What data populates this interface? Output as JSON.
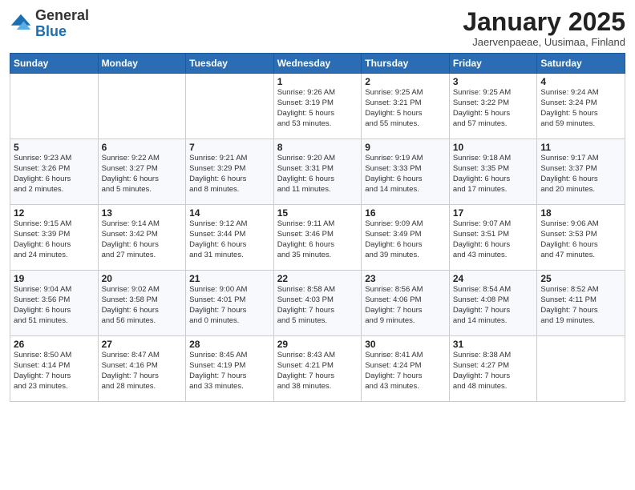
{
  "header": {
    "logo_general": "General",
    "logo_blue": "Blue",
    "month_title": "January 2025",
    "subtitle": "Jaervenpaeae, Uusimaa, Finland"
  },
  "weekdays": [
    "Sunday",
    "Monday",
    "Tuesday",
    "Wednesday",
    "Thursday",
    "Friday",
    "Saturday"
  ],
  "weeks": [
    [
      {
        "day": "",
        "info": ""
      },
      {
        "day": "",
        "info": ""
      },
      {
        "day": "",
        "info": ""
      },
      {
        "day": "1",
        "info": "Sunrise: 9:26 AM\nSunset: 3:19 PM\nDaylight: 5 hours\nand 53 minutes."
      },
      {
        "day": "2",
        "info": "Sunrise: 9:25 AM\nSunset: 3:21 PM\nDaylight: 5 hours\nand 55 minutes."
      },
      {
        "day": "3",
        "info": "Sunrise: 9:25 AM\nSunset: 3:22 PM\nDaylight: 5 hours\nand 57 minutes."
      },
      {
        "day": "4",
        "info": "Sunrise: 9:24 AM\nSunset: 3:24 PM\nDaylight: 5 hours\nand 59 minutes."
      }
    ],
    [
      {
        "day": "5",
        "info": "Sunrise: 9:23 AM\nSunset: 3:26 PM\nDaylight: 6 hours\nand 2 minutes."
      },
      {
        "day": "6",
        "info": "Sunrise: 9:22 AM\nSunset: 3:27 PM\nDaylight: 6 hours\nand 5 minutes."
      },
      {
        "day": "7",
        "info": "Sunrise: 9:21 AM\nSunset: 3:29 PM\nDaylight: 6 hours\nand 8 minutes."
      },
      {
        "day": "8",
        "info": "Sunrise: 9:20 AM\nSunset: 3:31 PM\nDaylight: 6 hours\nand 11 minutes."
      },
      {
        "day": "9",
        "info": "Sunrise: 9:19 AM\nSunset: 3:33 PM\nDaylight: 6 hours\nand 14 minutes."
      },
      {
        "day": "10",
        "info": "Sunrise: 9:18 AM\nSunset: 3:35 PM\nDaylight: 6 hours\nand 17 minutes."
      },
      {
        "day": "11",
        "info": "Sunrise: 9:17 AM\nSunset: 3:37 PM\nDaylight: 6 hours\nand 20 minutes."
      }
    ],
    [
      {
        "day": "12",
        "info": "Sunrise: 9:15 AM\nSunset: 3:39 PM\nDaylight: 6 hours\nand 24 minutes."
      },
      {
        "day": "13",
        "info": "Sunrise: 9:14 AM\nSunset: 3:42 PM\nDaylight: 6 hours\nand 27 minutes."
      },
      {
        "day": "14",
        "info": "Sunrise: 9:12 AM\nSunset: 3:44 PM\nDaylight: 6 hours\nand 31 minutes."
      },
      {
        "day": "15",
        "info": "Sunrise: 9:11 AM\nSunset: 3:46 PM\nDaylight: 6 hours\nand 35 minutes."
      },
      {
        "day": "16",
        "info": "Sunrise: 9:09 AM\nSunset: 3:49 PM\nDaylight: 6 hours\nand 39 minutes."
      },
      {
        "day": "17",
        "info": "Sunrise: 9:07 AM\nSunset: 3:51 PM\nDaylight: 6 hours\nand 43 minutes."
      },
      {
        "day": "18",
        "info": "Sunrise: 9:06 AM\nSunset: 3:53 PM\nDaylight: 6 hours\nand 47 minutes."
      }
    ],
    [
      {
        "day": "19",
        "info": "Sunrise: 9:04 AM\nSunset: 3:56 PM\nDaylight: 6 hours\nand 51 minutes."
      },
      {
        "day": "20",
        "info": "Sunrise: 9:02 AM\nSunset: 3:58 PM\nDaylight: 6 hours\nand 56 minutes."
      },
      {
        "day": "21",
        "info": "Sunrise: 9:00 AM\nSunset: 4:01 PM\nDaylight: 7 hours\nand 0 minutes."
      },
      {
        "day": "22",
        "info": "Sunrise: 8:58 AM\nSunset: 4:03 PM\nDaylight: 7 hours\nand 5 minutes."
      },
      {
        "day": "23",
        "info": "Sunrise: 8:56 AM\nSunset: 4:06 PM\nDaylight: 7 hours\nand 9 minutes."
      },
      {
        "day": "24",
        "info": "Sunrise: 8:54 AM\nSunset: 4:08 PM\nDaylight: 7 hours\nand 14 minutes."
      },
      {
        "day": "25",
        "info": "Sunrise: 8:52 AM\nSunset: 4:11 PM\nDaylight: 7 hours\nand 19 minutes."
      }
    ],
    [
      {
        "day": "26",
        "info": "Sunrise: 8:50 AM\nSunset: 4:14 PM\nDaylight: 7 hours\nand 23 minutes."
      },
      {
        "day": "27",
        "info": "Sunrise: 8:47 AM\nSunset: 4:16 PM\nDaylight: 7 hours\nand 28 minutes."
      },
      {
        "day": "28",
        "info": "Sunrise: 8:45 AM\nSunset: 4:19 PM\nDaylight: 7 hours\nand 33 minutes."
      },
      {
        "day": "29",
        "info": "Sunrise: 8:43 AM\nSunset: 4:21 PM\nDaylight: 7 hours\nand 38 minutes."
      },
      {
        "day": "30",
        "info": "Sunrise: 8:41 AM\nSunset: 4:24 PM\nDaylight: 7 hours\nand 43 minutes."
      },
      {
        "day": "31",
        "info": "Sunrise: 8:38 AM\nSunset: 4:27 PM\nDaylight: 7 hours\nand 48 minutes."
      },
      {
        "day": "",
        "info": ""
      }
    ]
  ]
}
